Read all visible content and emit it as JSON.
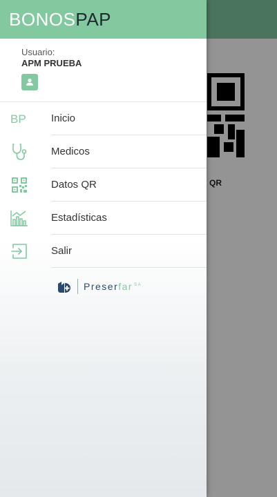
{
  "app": {
    "brand_part1": "BONOS",
    "brand_part2": "PAP",
    "accent_color": "#82c9a0"
  },
  "background": {
    "qr_label": "QR"
  },
  "user": {
    "caption": "Usuario:",
    "name": "APM PRUEBA",
    "avatar_icon": "person-icon"
  },
  "menu": {
    "items": [
      {
        "label": "Inicio",
        "icon": "bp-logo-icon"
      },
      {
        "label": "Medicos",
        "icon": "stethoscope-icon"
      },
      {
        "label": "Datos QR",
        "icon": "qr-code-icon"
      },
      {
        "label": "Estadísticas",
        "icon": "chart-icon"
      },
      {
        "label": "Salir",
        "icon": "exit-icon"
      }
    ]
  },
  "footer": {
    "logo_part1": "Preser",
    "logo_part2": "far",
    "logo_suffix": "SA"
  }
}
